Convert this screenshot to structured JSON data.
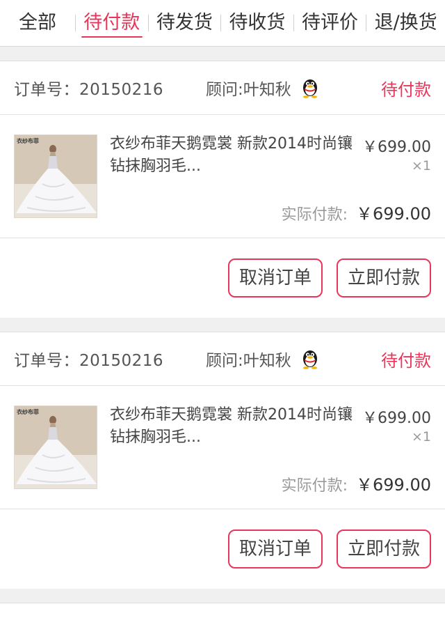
{
  "tabs": [
    "全部",
    "待付款",
    "待发货",
    "待收货",
    "待评价",
    "退/换货"
  ],
  "active_tab": "待付款",
  "colors": {
    "accent": "#e8355a",
    "bg_gap": "#f0f0f0"
  },
  "orders": [
    {
      "order_no": "订单号：20150216",
      "advisor": "顾问:叶知秋",
      "advisor_icon": "qq-penguin-icon",
      "status": "待付款",
      "thumb_brand": "衣纱布菲",
      "product_title": "衣纱布菲天鹅霓裳 新款2014时尚镶钻抹胸羽毛...",
      "price": "￥699.00",
      "qty": "×1",
      "total_label": "实际付款:",
      "total_amount": "￥699.00",
      "buttons": {
        "cancel": "取消订单",
        "pay": "立即付款"
      }
    },
    {
      "order_no": "订单号：20150216",
      "advisor": "顾问:叶知秋",
      "advisor_icon": "qq-penguin-icon",
      "status": "待付款",
      "thumb_brand": "衣纱布菲",
      "product_title": "衣纱布菲天鹅霓裳 新款2014时尚镶钻抹胸羽毛...",
      "price": "￥699.00",
      "qty": "×1",
      "total_label": "实际付款:",
      "total_amount": "￥699.00",
      "buttons": {
        "cancel": "取消订单",
        "pay": "立即付款"
      }
    }
  ]
}
